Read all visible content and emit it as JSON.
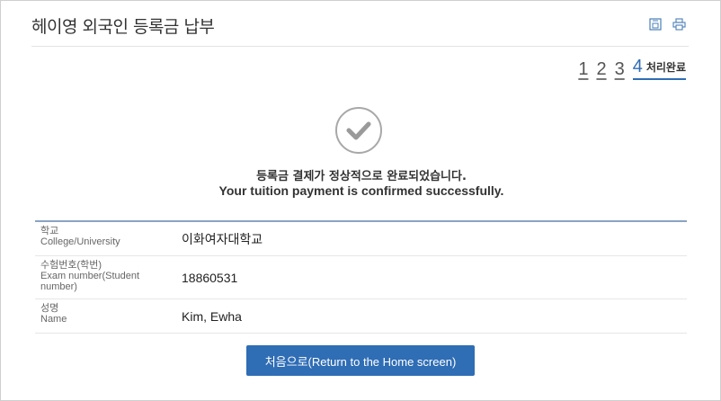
{
  "page": {
    "title": "헤이영 외국인 등록금 납부"
  },
  "toolbar": {
    "icons": [
      "save-icon",
      "print-icon"
    ]
  },
  "steps": {
    "items": [
      "1",
      "2",
      "3"
    ],
    "current": "4",
    "current_label": "처리완료"
  },
  "status": {
    "icon": "check-circle-icon",
    "message_ko": "등록금 결제가 정상적으로 완료되었습니다.",
    "message_en": "Your tuition payment is confirmed successfully."
  },
  "info": {
    "rows": [
      {
        "label_ko": "학교",
        "label_en": "College/University",
        "value": "이화여자대학교"
      },
      {
        "label_ko": "수험번호(학번)",
        "label_en": "Exam number(Student number)",
        "value": "18860531"
      },
      {
        "label_ko": "성명",
        "label_en": "Name",
        "value": "Kim, Ewha"
      }
    ]
  },
  "actions": {
    "home_label": "처음으로(Return to the Home screen)"
  },
  "colors": {
    "accent": "#2f6db5",
    "check": "#9a9a9a"
  }
}
